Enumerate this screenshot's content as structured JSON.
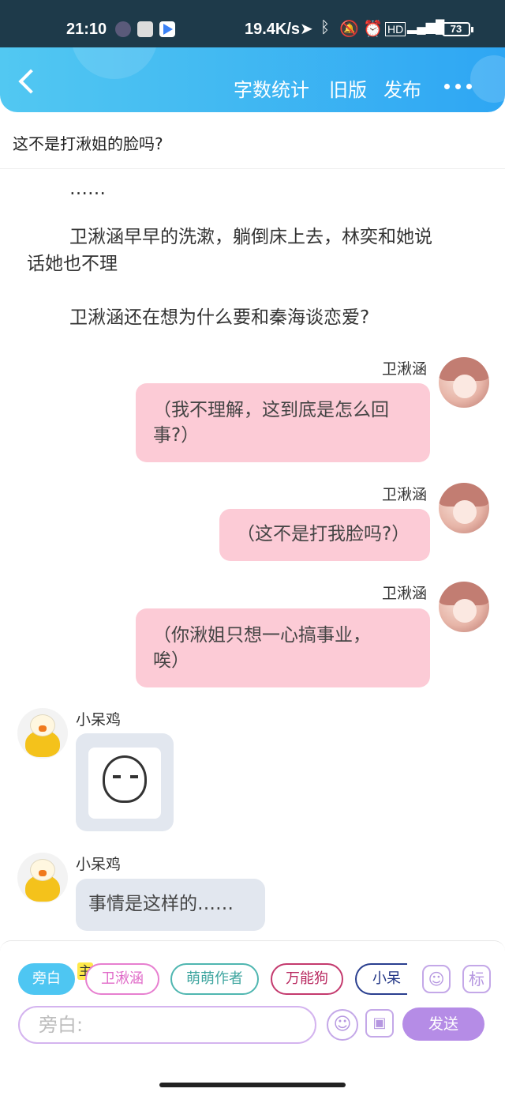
{
  "status_bar": {
    "time": "21:10",
    "network_speed": "19.4K/s",
    "battery": "73"
  },
  "header": {
    "word_count": "字数统计",
    "old_version": "旧版",
    "publish": "发布"
  },
  "chapter": {
    "title": "这不是打湫姐的脸吗?"
  },
  "narration": [
    "……",
    "卫湫涵早早的洗漱，躺倒床上去，林奕和她说",
    "话她也不理",
    "卫湫涵还在想为什么要和秦海谈恋爱?"
  ],
  "messages": [
    {
      "sender": "卫湫涵",
      "lines": [
        "（我不理解，这到底是怎么回",
        "事?）"
      ]
    },
    {
      "sender": "卫湫涵",
      "lines": [
        "（这不是打我脸吗?）"
      ]
    },
    {
      "sender": "卫湫涵",
      "lines": [
        "（你湫姐只想一心搞事业，",
        "唉）"
      ]
    },
    {
      "sender": "小呆鸡",
      "sticker": "meme-face"
    },
    {
      "sender": "小呆鸡",
      "lines": [
        "事情是这样的……"
      ]
    }
  ],
  "composer": {
    "roles": [
      "旁白",
      "卫湫涵",
      "萌萌作者",
      "万能狗",
      "小呆"
    ],
    "main_badge": "主",
    "label_btn": "标",
    "input_placeholder": "旁白:",
    "send": "发送"
  },
  "colors": {
    "accent": "#2ea6f3",
    "pink_bubble": "#fccbd6",
    "gray_bubble": "#e2e7ef",
    "send": "#b58ce6"
  }
}
